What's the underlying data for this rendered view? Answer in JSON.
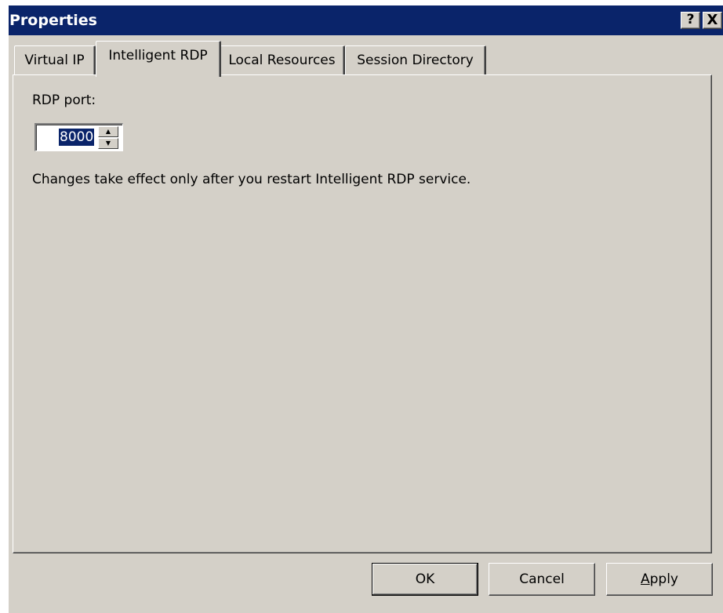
{
  "window": {
    "title": "Properties"
  },
  "titlebar_buttons": {
    "help": "?",
    "close": "X"
  },
  "tabs": [
    {
      "label": "Virtual IP",
      "active": false
    },
    {
      "label": "Intelligent RDP",
      "active": true
    },
    {
      "label": "Local Resources",
      "active": false
    },
    {
      "label": "Session Directory",
      "active": false
    }
  ],
  "rdp": {
    "port_label": "RDP port:",
    "port_value": "8000",
    "note": "Changes take effect only after you restart Intelligent RDP service."
  },
  "buttons": {
    "ok": "OK",
    "cancel": "Cancel",
    "apply_mnemonic": "A",
    "apply_rest": "pply"
  },
  "colors": {
    "titlebar": "#0a246a",
    "face": "#d4d0c8",
    "selection": "#0a246a"
  }
}
